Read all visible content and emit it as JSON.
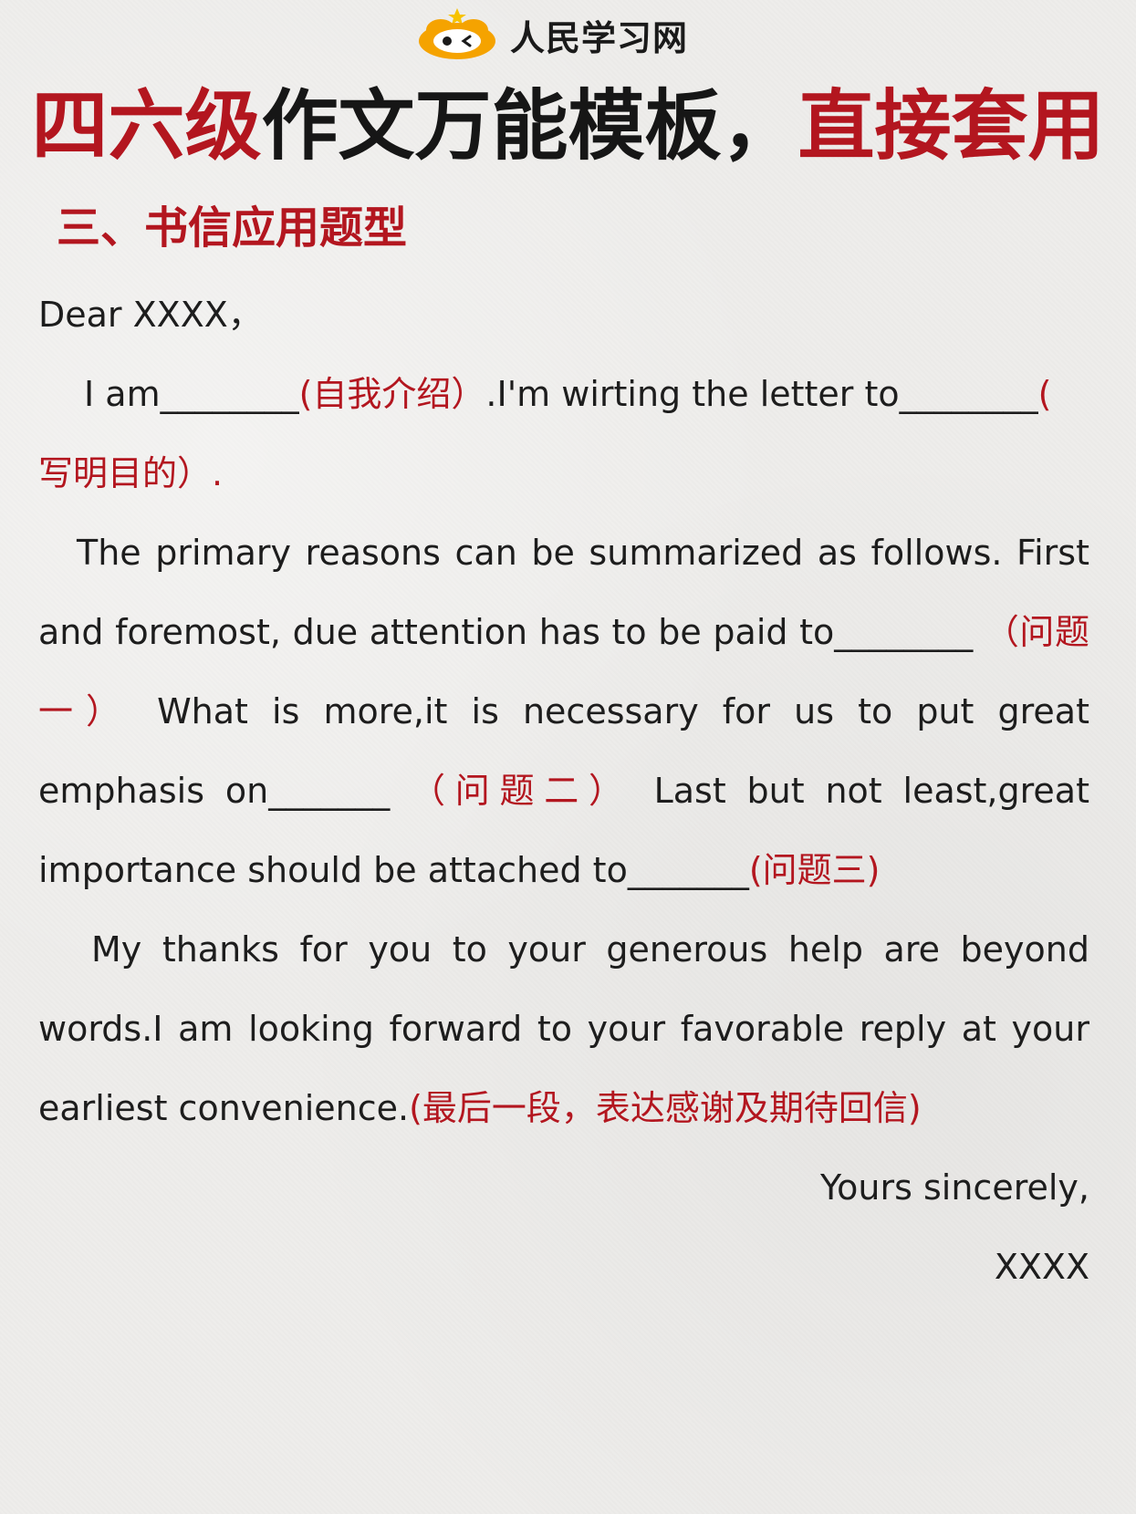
{
  "header": {
    "brand_name": "人民学习网",
    "logo_icon": "cartoon-face-logo-icon",
    "accent_color": "#b3161f",
    "logo_color": "#f5a300"
  },
  "title": {
    "part1": "四六级",
    "part2": "作文万能模板，",
    "part3": "直接套用"
  },
  "section": {
    "heading": "三、书信应用题型"
  },
  "letter": {
    "salutation": "Dear XXXX，",
    "p1": {
      "a": "I am________",
      "b": "(自我介绍）",
      "c": ".I'm wirting the letter to________",
      "d": "(",
      "e": "写明目的）."
    },
    "p2": {
      "l1": "The primary reasons can be summarized as follows. First",
      "l2a": "and foremost, due attention has to be paid to________",
      "l2b": "（问题",
      "l3a": "一）",
      "l3b": "What is more,it is necessary for us to put great",
      "l4a": "emphasis on_______",
      "l4b": "（问题二）",
      "l4c": "Last but not least,great",
      "l5a": "importance should be attached to_______",
      "l5b": "(问题三)"
    },
    "p3": {
      "l1": "My thanks for you to your generous help are beyond",
      "l2": "words.I am looking forward to your favorable reply at your",
      "l3a": "earliest convenience.",
      "l3b": "(最后一段，表达感谢及期待回信)"
    },
    "closing": "Yours sincerely,",
    "signature": "XXXX"
  }
}
